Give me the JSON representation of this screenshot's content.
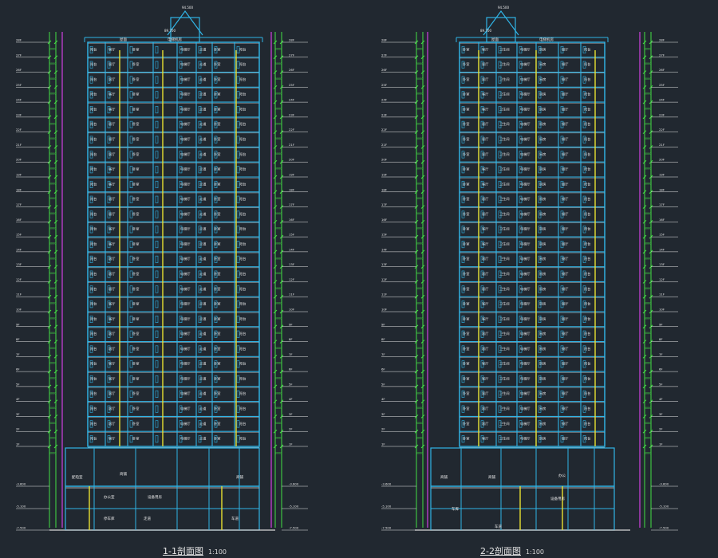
{
  "drawing": {
    "background": "#212830",
    "colors": {
      "structure": "#30b4e6",
      "dimension": "#44e044",
      "axis": "#d040e0",
      "text": "#e8e8e8",
      "accent": "#e8e030",
      "slab": "#d8d8d8"
    }
  },
  "sections": [
    {
      "id": "section-1-1",
      "title": "1-1剖面图",
      "scale": "1:100",
      "roof_labels": [
        "屋面",
        "电梯机房"
      ],
      "top_elevations": [
        "94.500",
        "89.700"
      ],
      "floor_count": 27,
      "room_labels": [
        "阳台",
        "客厅",
        "卧室",
        "电梯厅",
        "走道",
        "卧室",
        "阳台"
      ],
      "podium_labels": [
        "商铺",
        "配电室",
        "商铺",
        "办公室",
        "设备用房",
        "停车库",
        "走道",
        "车道"
      ],
      "basement_levels": [
        "-3.600",
        "-5.100",
        "-7.500"
      ]
    },
    {
      "id": "section-2-2",
      "title": "2-2剖面图",
      "scale": "1:100",
      "roof_labels": [
        "屋面",
        "电梯机房"
      ],
      "top_elevations": [
        "94.500",
        "89.700"
      ],
      "floor_count": 27,
      "room_labels": [
        "卧室",
        "客厅",
        "卫生间",
        "电梯厅",
        "厨房",
        "餐厅",
        "阳台"
      ],
      "podium_labels": [
        "商铺",
        "商铺",
        "办公",
        "设备用房",
        "车库",
        "车道"
      ],
      "basement_levels": [
        "-3.600",
        "-5.100",
        "-7.500"
      ]
    }
  ]
}
